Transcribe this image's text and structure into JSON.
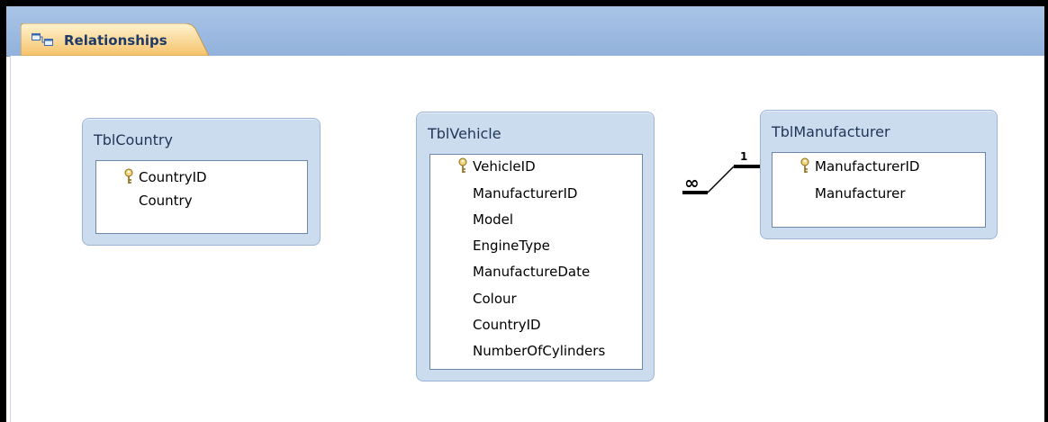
{
  "tab": {
    "label": "Relationships"
  },
  "tables": [
    {
      "name": "TblCountry",
      "fields": [
        {
          "name": "CountryID",
          "key": true
        },
        {
          "name": "Country",
          "key": false
        }
      ]
    },
    {
      "name": "TblVehicle",
      "fields": [
        {
          "name": "VehicleID",
          "key": true
        },
        {
          "name": "ManufacturerID",
          "key": false
        },
        {
          "name": "Model",
          "key": false
        },
        {
          "name": "EngineType",
          "key": false
        },
        {
          "name": "ManufactureDate",
          "key": false
        },
        {
          "name": "Colour",
          "key": false
        },
        {
          "name": "CountryID",
          "key": false
        },
        {
          "name": "NumberOfCylinders",
          "key": false
        }
      ]
    },
    {
      "name": "TblManufacturer",
      "fields": [
        {
          "name": "ManufacturerID",
          "key": true
        },
        {
          "name": "Manufacturer",
          "key": false
        }
      ]
    }
  ],
  "relationship": {
    "many_label": "∞",
    "one_label": "1"
  },
  "icons": {
    "tab": "relationships-icon",
    "key": "primary-key-icon"
  },
  "colors": {
    "tab_bg": "#f5c26a",
    "tabstrip": "#a9c4e6",
    "table_header": "#ccdcef"
  }
}
